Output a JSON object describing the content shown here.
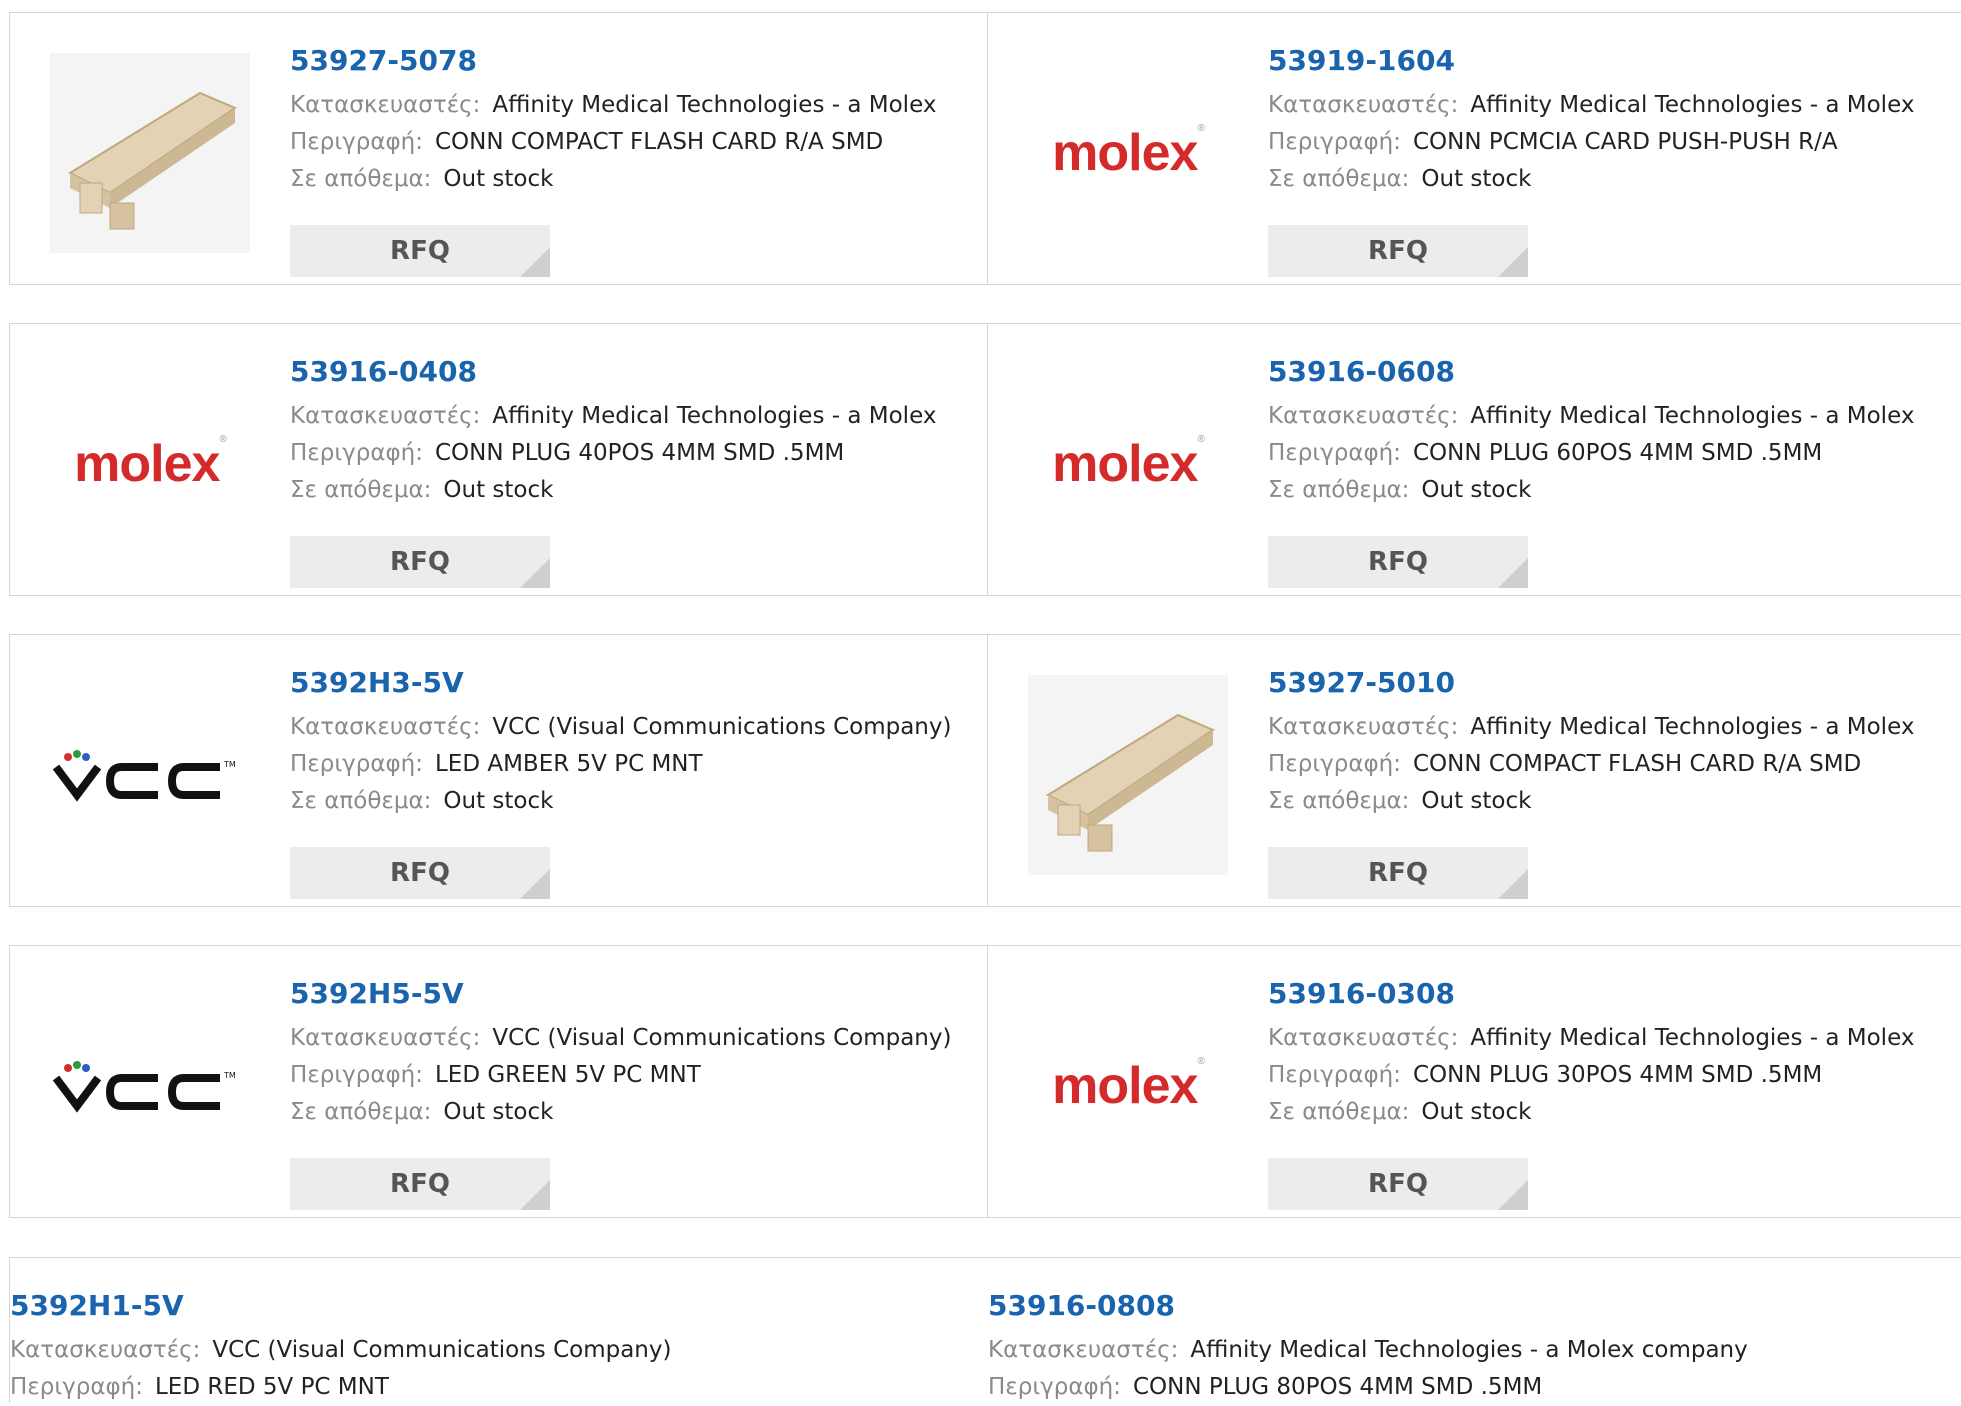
{
  "labels": {
    "manufacturer": "Κατασκευαστές:",
    "description": "Περιγραφή:",
    "stock": "Σε απόθεμα:",
    "rfq": "RFQ"
  },
  "products": [
    {
      "pn": "53927-5078",
      "manufacturer": "Affinity Medical Technologies - a Molex",
      "description": "CONN COMPACT FLASH CARD R/A SMD",
      "stock": "Out stock",
      "image": "connector-photo-icon"
    },
    {
      "pn": "53919-1604",
      "manufacturer": "Affinity Medical Technologies - a Molex",
      "description": "CONN PCMCIA CARD PUSH-PUSH R/A",
      "stock": "Out stock",
      "image": "molex-logo"
    },
    {
      "pn": "53916-0408",
      "manufacturer": "Affinity Medical Technologies - a Molex",
      "description": "CONN PLUG 40POS 4MM SMD .5MM",
      "stock": "Out stock",
      "image": "molex-logo"
    },
    {
      "pn": "53916-0608",
      "manufacturer": "Affinity Medical Technologies - a Molex",
      "description": "CONN PLUG 60POS 4MM SMD .5MM",
      "stock": "Out stock",
      "image": "molex-logo"
    },
    {
      "pn": "5392H3-5V",
      "manufacturer": "VCC (Visual Communications Company)",
      "description": "LED AMBER 5V PC MNT",
      "stock": "Out stock",
      "image": "vcc-logo"
    },
    {
      "pn": "53927-5010",
      "manufacturer": "Affinity Medical Technologies - a Molex",
      "description": "CONN COMPACT FLASH CARD R/A SMD",
      "stock": "Out stock",
      "image": "connector-photo-icon"
    },
    {
      "pn": "5392H5-5V",
      "manufacturer": "VCC (Visual Communications Company)",
      "description": "LED GREEN 5V PC MNT",
      "stock": "Out stock",
      "image": "vcc-logo"
    },
    {
      "pn": "53916-0308",
      "manufacturer": "Affinity Medical Technologies - a Molex",
      "description": "CONN PLUG 30POS 4MM SMD .5MM",
      "stock": "Out stock",
      "image": "molex-logo"
    },
    {
      "pn": "5392H1-5V",
      "manufacturer": "VCC (Visual Communications Company)",
      "description": "LED RED 5V PC MNT"
    },
    {
      "pn": "53916-0808",
      "manufacturer": "Affinity Medical Technologies - a Molex company",
      "description": "CONN PLUG 80POS 4MM SMD .5MM"
    }
  ],
  "logos": {
    "molex_text": "molex",
    "vcc_text": "VCC"
  },
  "colors": {
    "link": "#1a64ad",
    "molex_red": "#d42a2a",
    "border": "#d6d6d6",
    "rfq_bg": "#ececec"
  }
}
